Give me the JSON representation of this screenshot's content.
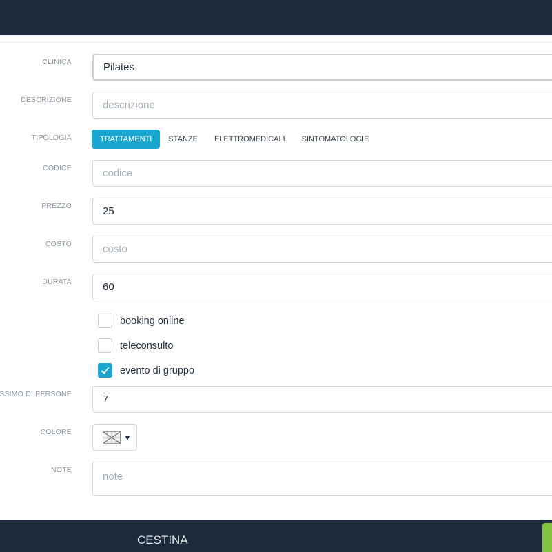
{
  "form": {
    "clinica": {
      "label": "CLINICA",
      "value": "Pilates"
    },
    "descrizione": {
      "label": "DESCRIZIONE",
      "placeholder": "descrizione"
    },
    "tipologia": {
      "label": "TIPOLOGIA",
      "tabs": [
        {
          "label": "TRATTAMENTI",
          "active": true
        },
        {
          "label": "STANZE",
          "active": false
        },
        {
          "label": "ELETTROMEDICALI",
          "active": false
        },
        {
          "label": "SINTOMATOLOGIE",
          "active": false
        }
      ]
    },
    "codice": {
      "label": "CODICE",
      "placeholder": "codice"
    },
    "prezzo": {
      "label": "PREZZO",
      "value": "25"
    },
    "costo": {
      "label": "COSTO",
      "placeholder": "costo"
    },
    "durata": {
      "label": "DURATA",
      "value": "60"
    },
    "checkboxes": [
      {
        "label": "booking online",
        "checked": false
      },
      {
        "label": "teleconsulto",
        "checked": false
      },
      {
        "label": "evento di gruppo",
        "checked": true
      }
    ],
    "max_persone": {
      "label": "ASSIMO DI PERSONE",
      "value": "7"
    },
    "colore": {
      "label": "COLORE",
      "caret": "▼"
    },
    "note": {
      "label": "NOTE",
      "placeholder": "note"
    }
  },
  "footer": {
    "label": "CESTINA"
  },
  "colors": {
    "topbar": "#1c2a3b",
    "accent": "#19a7cf",
    "confirm": "#82c341"
  }
}
